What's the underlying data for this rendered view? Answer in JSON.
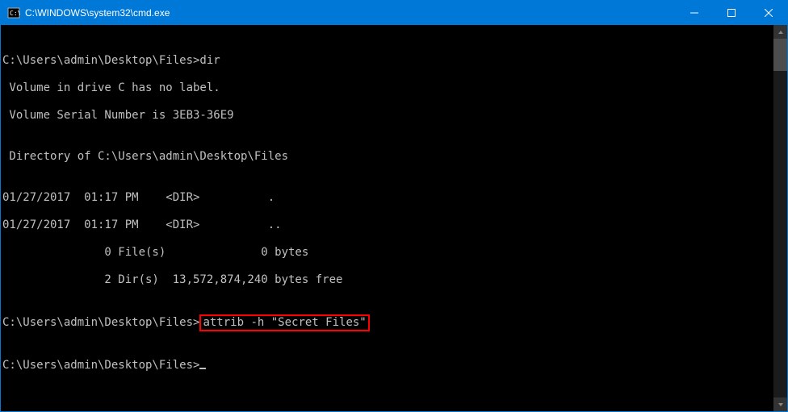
{
  "titlebar": {
    "title": "C:\\WINDOWS\\system32\\cmd.exe"
  },
  "terminal": {
    "blank_top": "",
    "line1": "C:\\Users\\admin\\Desktop\\Files>dir",
    "line2": " Volume in drive C has no label.",
    "line3": " Volume Serial Number is 3EB3-36E9",
    "blank1": "",
    "line4": " Directory of C:\\Users\\admin\\Desktop\\Files",
    "blank2": "",
    "line5": "01/27/2017  01:17 PM    <DIR>          .",
    "line6": "01/27/2017  01:17 PM    <DIR>          ..",
    "line7": "               0 File(s)              0 bytes",
    "line8": "               2 Dir(s)  13,572,874,240 bytes free",
    "blank3": "",
    "prompt2_prefix": "C:\\Users\\admin\\Desktop\\Files>",
    "prompt2_cmd": "attrib -h \"Secret Files\"",
    "blank4": "",
    "prompt3": "C:\\Users\\admin\\Desktop\\Files>"
  }
}
